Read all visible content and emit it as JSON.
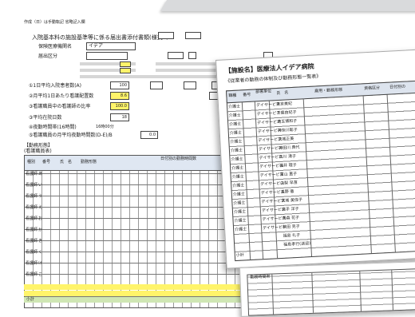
{
  "header_caption": "作成（日）は手動転記 省略記入欄",
  "form": {
    "title": "入院基本料の施設基準等に係る届出書添付書類(様式9)",
    "facility_label": "保険医療機関名",
    "facility_value": "イデア",
    "notification_label": "届出区分",
    "beds_label": "①1日平均入院患者数(A)",
    "beds_value": "100",
    "nurses_label": "②月平均1日あたり看護配置数",
    "nurses_value": "8.6",
    "ratio_label": "③看護職員中の看護師の比率",
    "ratio_value": "100.0",
    "stay_label": "③平均在院日数",
    "stay_value": "18",
    "night_label": "④夜勤時間帯(16時間)",
    "night_time": "16時00分",
    "monthly_label": "⑤看護職員の月平均夜勤時間数(D-E)/B",
    "monthly_value": "0.0"
  },
  "staff_section": {
    "title": "【勤務形態】",
    "subtitle": "(看護職員表)",
    "col_type": "種別",
    "col_no": "番号",
    "col_name": "氏　名",
    "col_ward": "勤務形態",
    "col_days": "日付別の勤務時間数",
    "rows": [
      "看護師",
      "看護師",
      "看護師",
      "看護師",
      "看護師",
      "看護師",
      "看護師",
      "看護師",
      "看護師",
      "看護師",
      "看護師",
      "看護師",
      "看護師"
    ],
    "names": [
      "あ",
      "い",
      "う",
      "え",
      "お",
      "か",
      "き",
      "く",
      "け",
      "こ",
      "さ",
      "し",
      "す"
    ],
    "total_label": "小計"
  },
  "duty_doc": {
    "title": "【施設名】医療法人イデア病院",
    "subtitle": "《従業者の勤務の体制及び勤務形態一覧表》",
    "col_type": "職種",
    "col_no": "番号",
    "col_unit": "部署単位",
    "col_name": "氏　名",
    "col_form": "雇用・勤務形態",
    "col_qual": "資格区分",
    "col_date": "日付別の",
    "types": [
      "介護士",
      "介護士",
      "介護士",
      "介護士",
      "介護士",
      "介護士",
      "介護士",
      "介護士",
      "介護士",
      "介護士",
      "介護士",
      "介護士",
      "介護士",
      "介護士",
      "介護士"
    ],
    "units": [
      "デイサービス",
      "デイサービス",
      "デイサービス",
      "デイサービス",
      "デイサービス",
      "デイサービス",
      "デイサービス",
      "デイサービス",
      "デイサービス",
      "デイサービス",
      "デイサービス",
      "デイサービス",
      "デイサービス",
      "デイサービス",
      "デイサービス"
    ],
    "names": [
      "東京美紀",
      "千葉由紀子",
      "埼玉博和子",
      "神奈川聡子",
      "茨城正美",
      "神田川 典代",
      "石川 清子",
      "福井 理子",
      "富山 直子",
      "山梨 早苗",
      "長野 徹",
      "宮城 美佳子",
      "岩手 洋子",
      "青森 花子",
      "秋田 克子",
      "福島 礼子",
      "福島孝行(送迎)"
    ],
    "total_label": "小計"
  },
  "shift_doc": {
    "header": "勤務時間帯"
  }
}
